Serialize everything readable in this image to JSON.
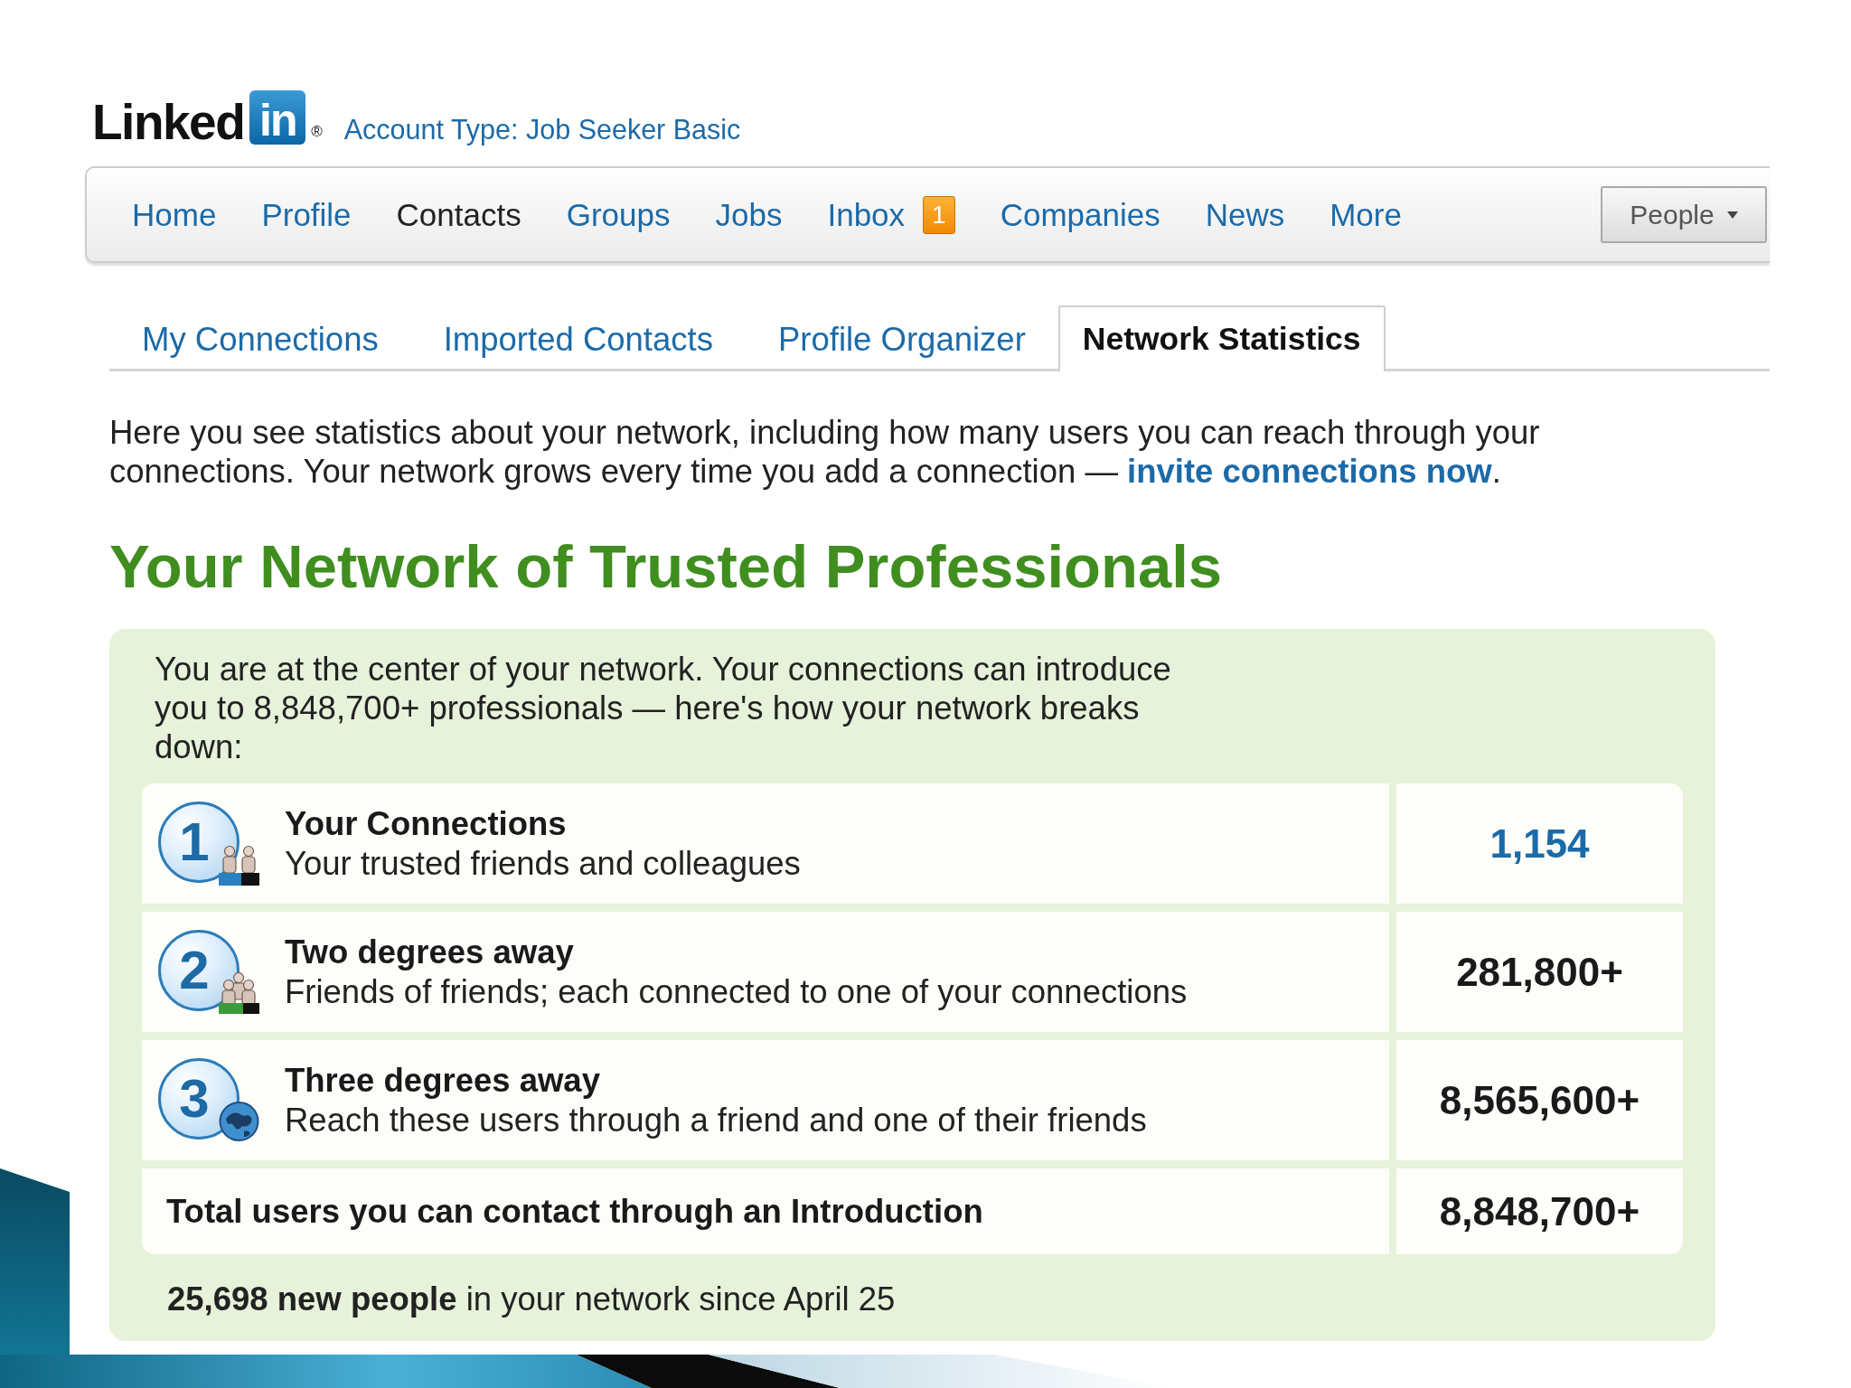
{
  "header": {
    "logo": {
      "wordmark": "Linked",
      "tile": "in",
      "mark": "®"
    },
    "account_type": "Account Type: Job Seeker Basic"
  },
  "nav": {
    "items": [
      {
        "label": "Home",
        "selected": false
      },
      {
        "label": "Profile",
        "selected": false
      },
      {
        "label": "Contacts",
        "selected": true
      },
      {
        "label": "Groups",
        "selected": false
      },
      {
        "label": "Jobs",
        "selected": false
      },
      {
        "label": "Inbox",
        "selected": false,
        "badge": "1"
      },
      {
        "label": "Companies",
        "selected": false
      },
      {
        "label": "News",
        "selected": false
      },
      {
        "label": "More",
        "selected": false
      }
    ],
    "search_scope": "People"
  },
  "tabs": [
    {
      "label": "My Connections",
      "selected": false
    },
    {
      "label": "Imported Contacts",
      "selected": false
    },
    {
      "label": "Profile Organizer",
      "selected": false
    },
    {
      "label": "Network Statistics",
      "selected": true
    }
  ],
  "intro": {
    "text": "Here you see statistics about your network, including how many users you can reach through your connections. Your network grows every time you add a connection — ",
    "link": "invite connections now",
    "after": "."
  },
  "heading": "Your Network of Trusted Professionals",
  "summary": "You are at the center of your network. Your connections can introduce you to 8,848,700+ professionals — here's how your network breaks down:",
  "degrees": [
    {
      "kind": "pair",
      "number": "1",
      "title": "Your Connections",
      "description": "Your trusted friends and colleagues",
      "count": "1,154",
      "link": true
    },
    {
      "kind": "group",
      "number": "2",
      "title": "Two degrees away",
      "description": "Friends of friends; each connected to one of your connections",
      "count": "281,800+",
      "link": false
    },
    {
      "kind": "globe",
      "number": "3",
      "title": "Three degrees away",
      "description": "Reach these users through a friend and one of their friends",
      "count": "8,565,600+",
      "link": false
    }
  ],
  "total": {
    "label": "Total users you can contact through an Introduction",
    "count": "8,848,700+"
  },
  "footer": "**25,698 new people** in your network since April 25"
}
